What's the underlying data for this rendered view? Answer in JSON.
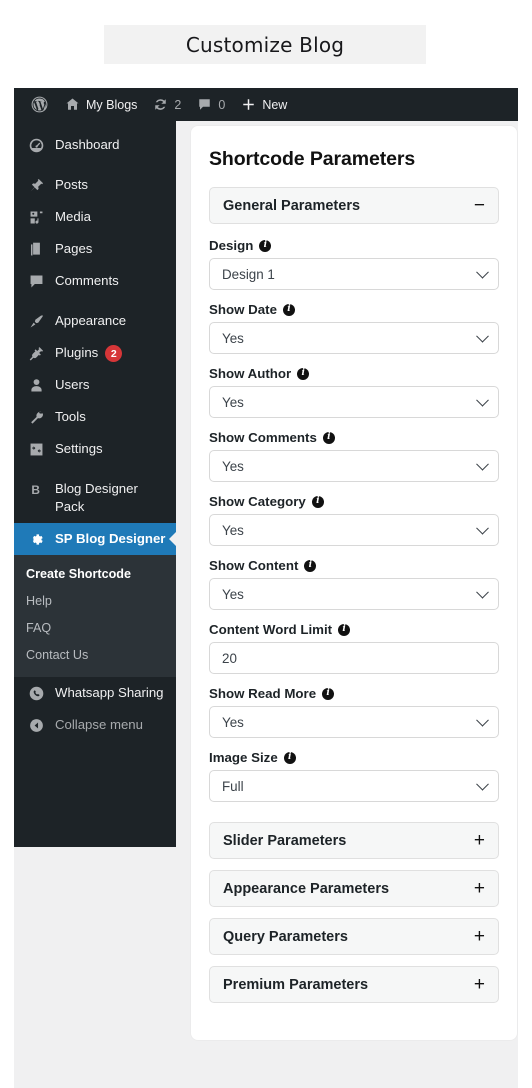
{
  "page": {
    "title": "Customize Blog"
  },
  "adminbar": {
    "logo": "wordpress-logo",
    "site_label": "My Blogs",
    "updates_count": "2",
    "comments_count": "0",
    "new_label": "New"
  },
  "sidebar": {
    "items": [
      {
        "label": "Dashboard",
        "icon": "dashboard-icon",
        "badge": ""
      },
      {
        "label": "Posts",
        "icon": "pin-icon",
        "badge": ""
      },
      {
        "label": "Media",
        "icon": "media-icon",
        "badge": ""
      },
      {
        "label": "Pages",
        "icon": "pages-icon",
        "badge": ""
      },
      {
        "label": "Comments",
        "icon": "comments-icon",
        "badge": ""
      },
      {
        "label": "Appearance",
        "icon": "brush-icon",
        "badge": ""
      },
      {
        "label": "Plugins",
        "icon": "plug-icon",
        "badge": "2"
      },
      {
        "label": "Users",
        "icon": "user-icon",
        "badge": ""
      },
      {
        "label": "Tools",
        "icon": "wrench-icon",
        "badge": ""
      },
      {
        "label": "Settings",
        "icon": "settings-icon",
        "badge": ""
      },
      {
        "label": "Blog Designer Pack",
        "icon": "letter-b-icon",
        "badge": ""
      },
      {
        "label": "SP Blog Designer",
        "icon": "gear-icon",
        "badge": ""
      }
    ],
    "submenu": [
      {
        "label": "Create Shortcode"
      },
      {
        "label": "Help"
      },
      {
        "label": "FAQ"
      },
      {
        "label": "Contact Us"
      }
    ],
    "footer_items": [
      {
        "label": "Whatsapp Sharing",
        "icon": "whatsapp-icon"
      },
      {
        "label": "Collapse menu",
        "icon": "collapse-arrow-icon"
      }
    ],
    "accent_color": "#1f7ab8",
    "background_color": "#1d2327",
    "badge_color": "#d63638"
  },
  "main": {
    "card_title": "Shortcode Parameters",
    "open_section": {
      "label": "General Parameters",
      "sign": "−"
    },
    "fields": [
      {
        "label": "Design",
        "value": "Design 1",
        "type": "select"
      },
      {
        "label": "Show Date",
        "value": "Yes",
        "type": "select"
      },
      {
        "label": "Show Author",
        "value": "Yes",
        "type": "select"
      },
      {
        "label": "Show Comments",
        "value": "Yes",
        "type": "select"
      },
      {
        "label": "Show Category",
        "value": "Yes",
        "type": "select"
      },
      {
        "label": "Show Content",
        "value": "Yes",
        "type": "select"
      },
      {
        "label": "Content Word Limit",
        "value": "20",
        "type": "text"
      },
      {
        "label": "Show Read More",
        "value": "Yes",
        "type": "select"
      },
      {
        "label": "Image Size",
        "value": "Full",
        "type": "select"
      }
    ],
    "collapsed_sections": [
      {
        "label": "Slider Parameters",
        "sign": "+"
      },
      {
        "label": "Appearance Parameters",
        "sign": "+"
      },
      {
        "label": "Query Parameters",
        "sign": "+"
      },
      {
        "label": "Premium Parameters",
        "sign": "+"
      }
    ]
  }
}
